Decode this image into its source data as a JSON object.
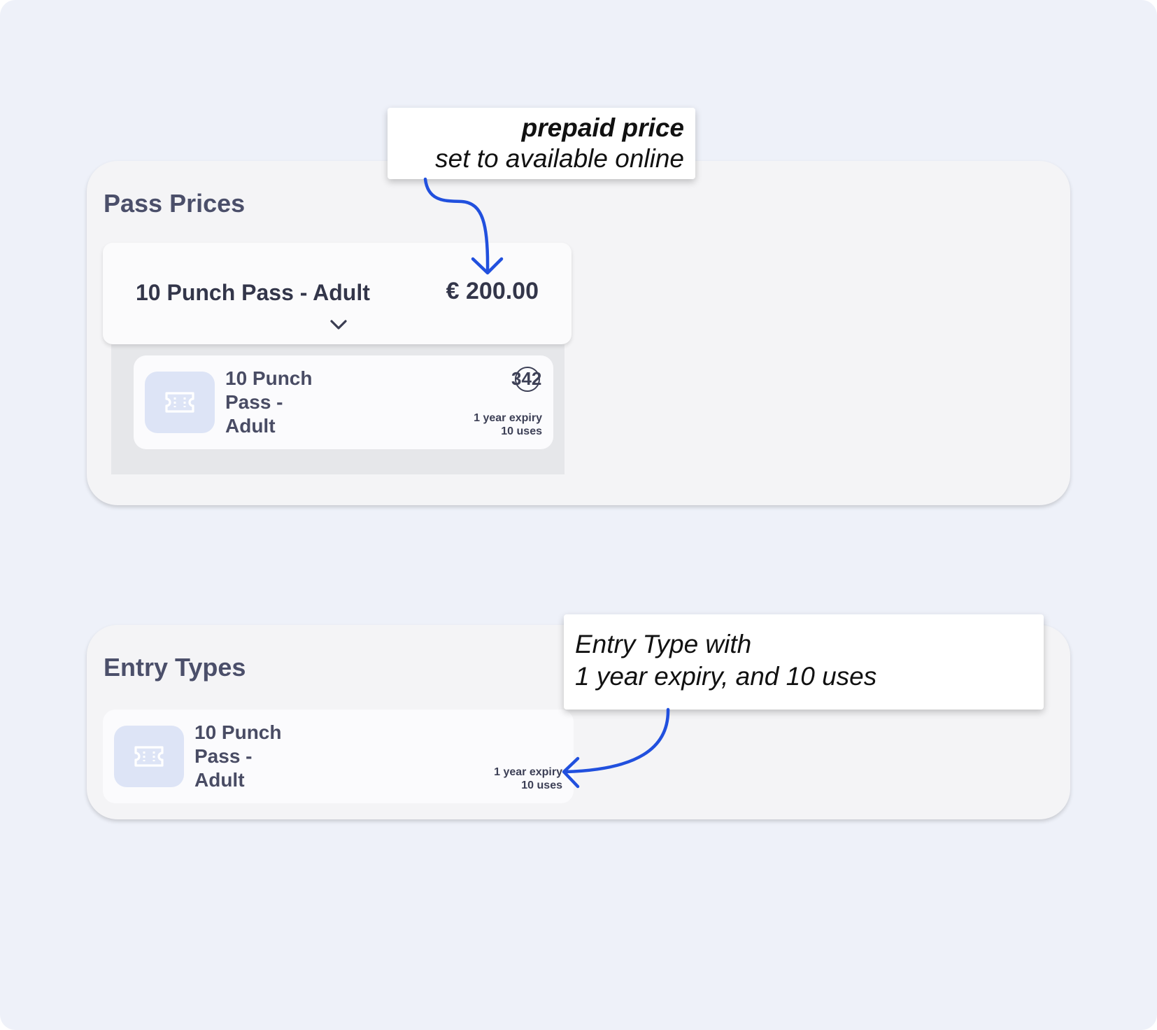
{
  "pass_prices": {
    "title": "Pass Prices",
    "price_item": {
      "name": "10 Punch Pass - Adult",
      "price": "€ 200.00"
    },
    "entry_type": {
      "name": "10 Punch Pass - Adult",
      "id_badge": "342",
      "expiry": "1 year expiry",
      "uses": "10 uses"
    }
  },
  "entry_types": {
    "title": "Entry Types",
    "item": {
      "name": "10 Punch Pass - Adult",
      "expiry": "1 year expiry",
      "uses": "10 uses"
    }
  },
  "annotations": {
    "prepaid": {
      "line1": "prepaid price",
      "line2": "set to available online"
    },
    "entry_type": {
      "line1": "Entry Type with",
      "line2": "1 year expiry, and 10 uses"
    }
  },
  "colors": {
    "background": "#eef1f9",
    "panel": "#f4f4f6",
    "annotation_arrow": "#2150de",
    "ticket_tile": "#dde4f6",
    "ticket_icon": "#ffffff"
  },
  "icons": {
    "ticket": "ticket-icon",
    "expand": "chevron-down-icon",
    "badge": "circle-badge-icon",
    "annotation_arrow": "curved-arrow-icon"
  }
}
